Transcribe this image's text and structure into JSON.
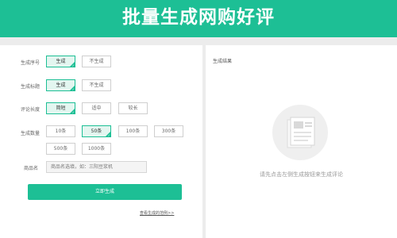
{
  "header": {
    "title": "批量生成网购好评"
  },
  "form": {
    "rows": {
      "serial": {
        "label": "生成序号",
        "options": [
          "生成",
          "不生成"
        ],
        "selected": 0
      },
      "heading": {
        "label": "生成标题",
        "options": [
          "生成",
          "不生成"
        ],
        "selected": 0
      },
      "length": {
        "label": "评论长度",
        "options": [
          "简短",
          "适中",
          "较长"
        ],
        "selected": 0
      },
      "count": {
        "label": "生成数量",
        "options": [
          "10条",
          "50条",
          "100条",
          "300条",
          "500条",
          "1000条"
        ],
        "selected": 1
      },
      "product": {
        "label": "商品名",
        "placeholder": "商品名选填，如：三阳豆浆机"
      }
    },
    "generate_label": "立即生成",
    "example_link": "查看生成的范例>>"
  },
  "result": {
    "title": "生成结果",
    "empty_text": "请先点击左侧生成按钮来生成评论"
  },
  "colors": {
    "accent": "#1dbf95",
    "selected_bg": "#e3f6f0",
    "page_bg": "#ececec"
  },
  "icons": {
    "empty_state": "document-illustration-icon"
  }
}
